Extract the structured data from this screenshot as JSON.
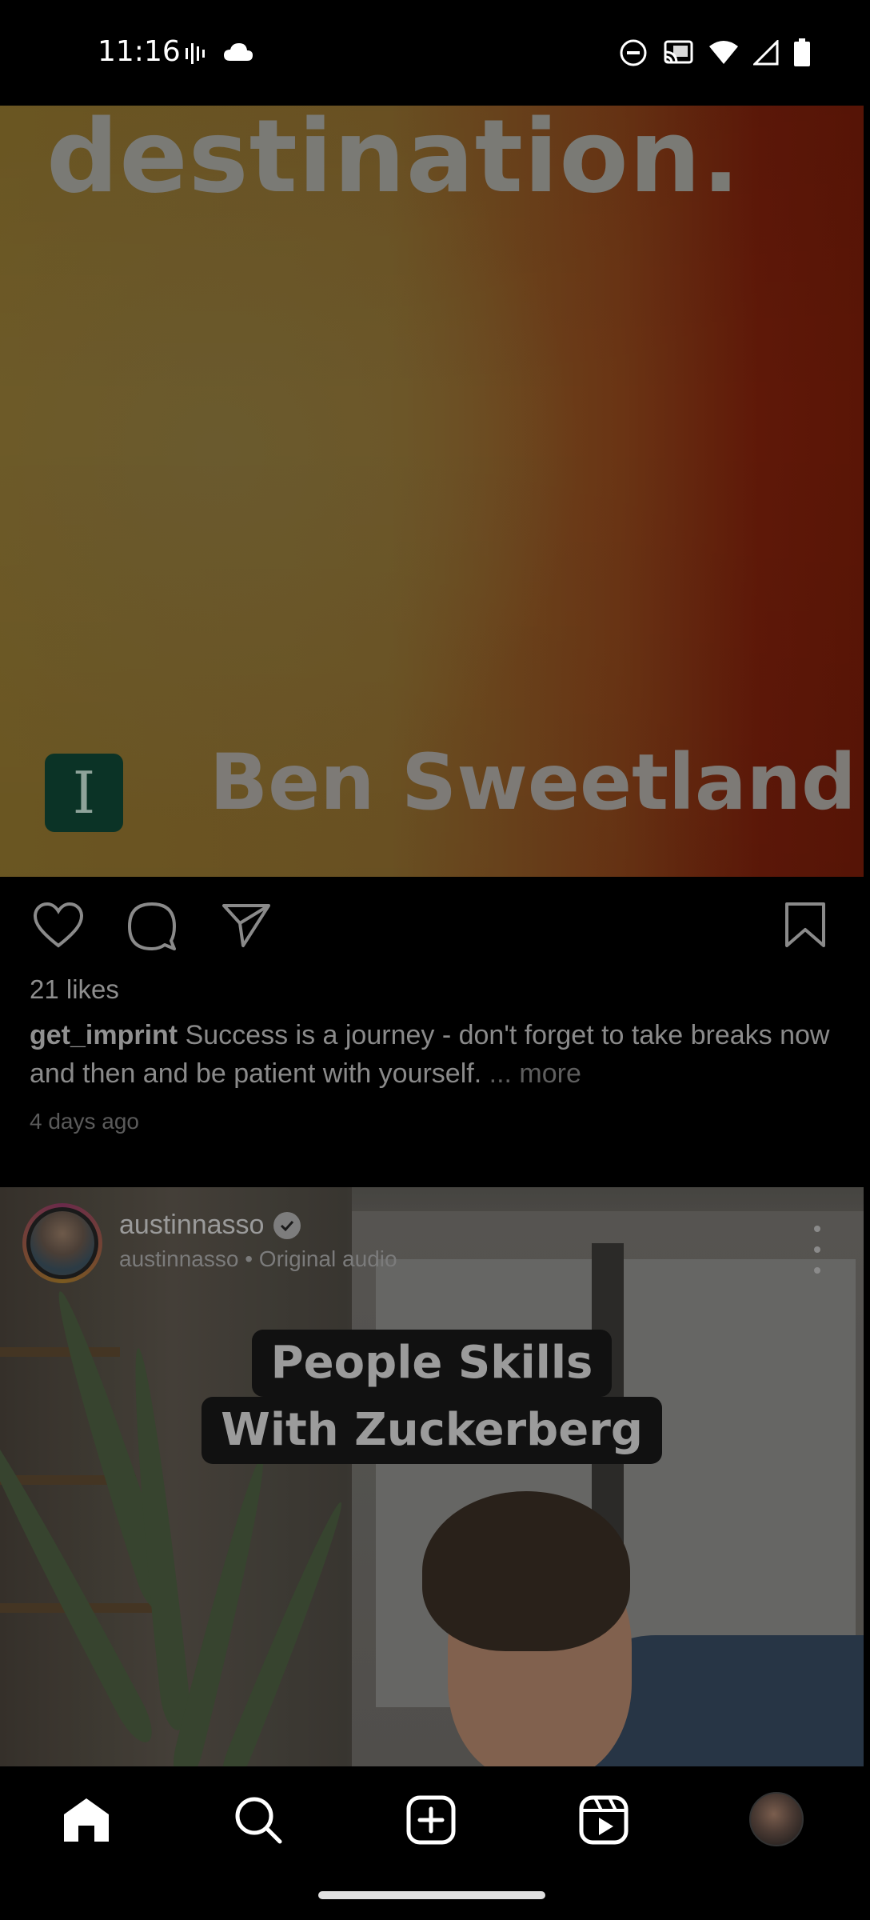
{
  "status_bar": {
    "time": "11:16",
    "left_icons": [
      "voicemail-icon",
      "cloud-icon"
    ],
    "right_icons": [
      "do-not-disturb-icon",
      "cast-icon",
      "wifi-icon",
      "signal-icon",
      "battery-icon"
    ]
  },
  "post1": {
    "media": {
      "headline": "destination.",
      "logo_letter": "I",
      "author": "Ben Sweetland"
    },
    "likes": "21 likes",
    "caption": {
      "username": "get_imprint",
      "text": "Success is a journey - don't forget to take breaks now and then and be patient with yourself.",
      "more": "... more"
    },
    "timestamp": "4 days ago"
  },
  "post2": {
    "username": "austinnasso",
    "subtitle": "austinnasso • Original audio",
    "title_lines": [
      "People Skills",
      "With Zuckerberg"
    ]
  },
  "nav": {
    "items": [
      "home-icon",
      "search-icon",
      "create-icon",
      "reels-icon",
      "profile-avatar"
    ]
  },
  "colors": {
    "background": "#000000",
    "dimmed_text": "#8e8e8e"
  }
}
